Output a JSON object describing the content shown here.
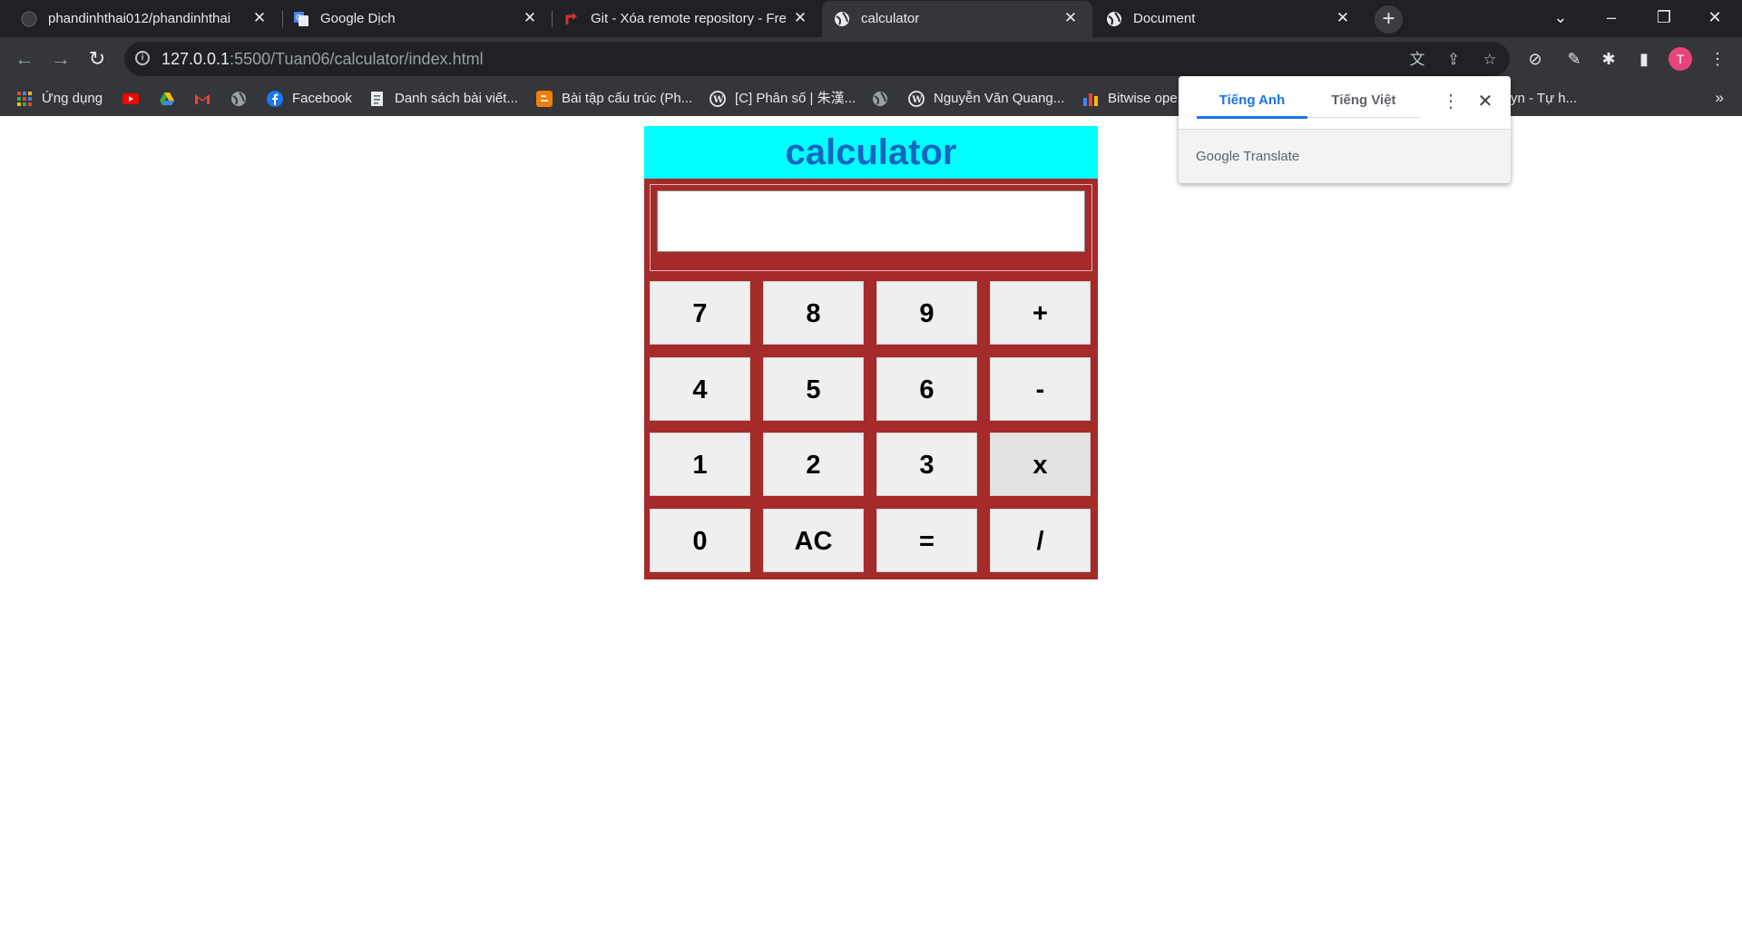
{
  "browser": {
    "tabs": [
      {
        "title": "phandinhthai012/phandinhthai",
        "icon": "github-icon",
        "active": false
      },
      {
        "title": "Google Dịch",
        "icon": "google-translate-icon",
        "active": false
      },
      {
        "title": "Git - Xóa remote repository - Fre",
        "icon": "git-icon",
        "active": false
      },
      {
        "title": "calculator",
        "icon": "globe-icon",
        "active": true
      },
      {
        "title": "Document",
        "icon": "globe-icon",
        "active": false
      }
    ],
    "address": {
      "host": "127.0.0.1",
      "path": ":5500/Tuan06/calculator/index.html"
    },
    "profile_initial": "T",
    "bookmarks": [
      {
        "label": "Ứng dụng",
        "icon": "apps-grid-icon",
        "color": "#ea4335"
      },
      {
        "label": "",
        "icon": "youtube-icon",
        "color": "#ff0000"
      },
      {
        "label": "",
        "icon": "google-drive-icon",
        "color": "#34a853"
      },
      {
        "label": "",
        "icon": "gmail-icon",
        "color": "#ea4335"
      },
      {
        "label": "",
        "icon": "globe-icon",
        "color": "#9aa0a6"
      },
      {
        "label": "Facebook",
        "icon": "facebook-icon",
        "color": "#1877f2"
      },
      {
        "label": "Danh sách bài viết...",
        "icon": "document-icon",
        "color": "#e8eaed"
      },
      {
        "label": "Bài tập cấu trúc (Ph...",
        "icon": "blogger-icon",
        "color": "#f57d00"
      },
      {
        "label": "[C] Phân số | 朱漢...",
        "icon": "wordpress-icon",
        "color": "#e8eaed"
      },
      {
        "label": "",
        "icon": "globe-icon",
        "color": "#9aa0a6"
      },
      {
        "label": "Nguyễn Văn Quang...",
        "icon": "wordpress-icon",
        "color": "#e8eaed"
      },
      {
        "label": "Bitwise ope",
        "icon": "bar-chart-icon",
        "color": "#fbbc04"
      },
      {
        "label": "yn - Tự h...",
        "icon": "",
        "color": ""
      }
    ],
    "bookmarks_more": "»"
  },
  "translate_popup": {
    "tab_source": "Tiếng Anh",
    "tab_target": "Tiếng Việt",
    "brand_google": "Google",
    "brand_translate": "Translate"
  },
  "calculator": {
    "title": "calculator",
    "display_value": "",
    "keys": [
      "7",
      "8",
      "9",
      "+",
      "4",
      "5",
      "6",
      "-",
      "1",
      "2",
      "3",
      "x",
      "0",
      "AC",
      "=",
      "/"
    ],
    "colors": {
      "title_bg": "#00ffff",
      "title_text": "#1565c0",
      "body_bg": "#a52a2a",
      "key_bg": "#efefef"
    }
  }
}
